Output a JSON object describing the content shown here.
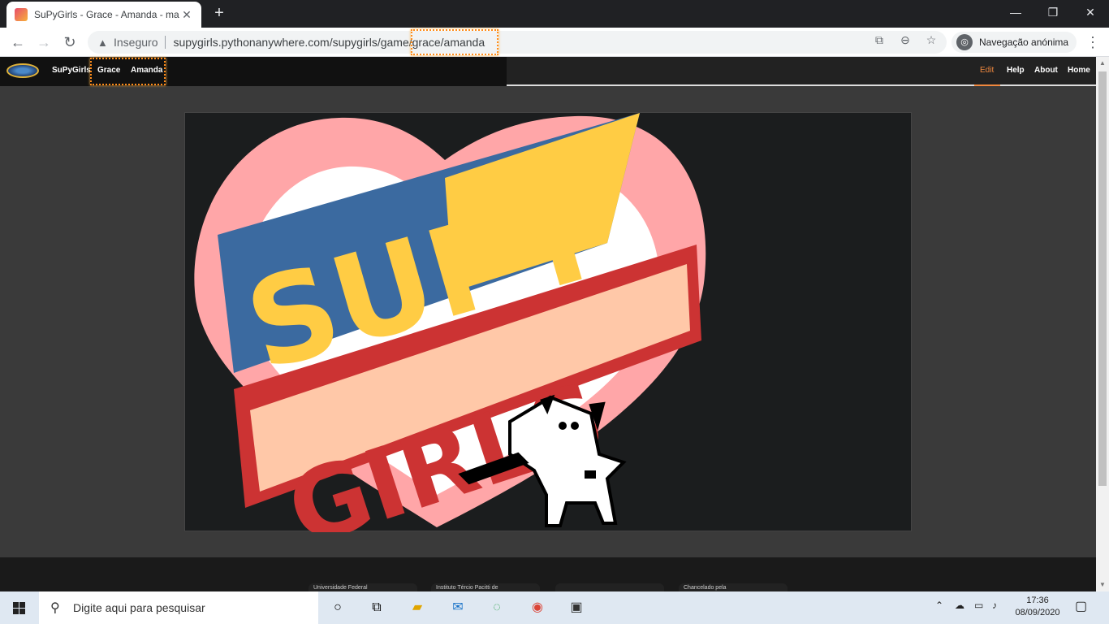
{
  "browser": {
    "tab_title": "SuPyGirls - Grace - Amanda - ma",
    "tab_close": "✕",
    "new_tab": "+",
    "window": {
      "minimize": "—",
      "maximize": "❐",
      "close": "✕"
    },
    "omnibox": {
      "security_label": "Inseguro",
      "url_host": "supygirls.pythonanywhere.com/supygirls/game",
      "url_path": "/grace/amanda"
    },
    "incognito_label": "Navegação anónima"
  },
  "site_nav": {
    "brand": "SuPyGirls",
    "crumb1": "Grace",
    "crumb2": "Amanda",
    "right": [
      "Edit",
      "Help",
      "About",
      "Home"
    ]
  },
  "game_logo": {
    "line1": "SUPY",
    "line2": "GIRLS"
  },
  "footer": {
    "sponsors": [
      "Universidade Federal",
      "Instituto Tércio Pacitti de",
      "",
      "Chancelado pela"
    ]
  },
  "taskbar": {
    "search_placeholder": "Digite aqui para pesquisar",
    "time": "17:36",
    "date": "08/09/2020"
  },
  "colors": {
    "accent_edit": "#f0883e",
    "heart_outer": "#ffa6a8",
    "logo_blue": "#3b6aa0",
    "logo_yellow": "#ffcc44",
    "logo_red": "#cc3333",
    "logo_peach": "#ffc8a8"
  }
}
